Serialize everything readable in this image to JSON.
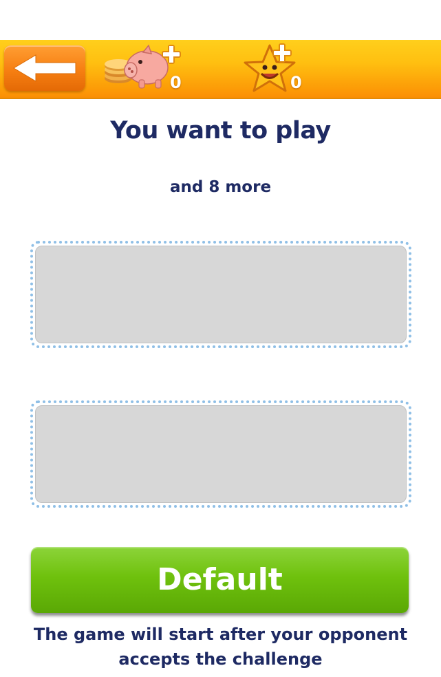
{
  "header": {
    "back_icon": "left-arrow-icon",
    "coins": {
      "icon": "piggy-bank-coins-icon",
      "count": "0"
    },
    "stars": {
      "icon": "smiling-star-icon",
      "count": "0"
    }
  },
  "main": {
    "title": "You want to play",
    "subtitle": "and 8 more",
    "default_button_label": "Default",
    "footer_message": "The game will start after your opponent accepts the challenge"
  },
  "colors": {
    "header_orange": "#fb8f04",
    "header_yellow": "#ffcf1c",
    "text_navy": "#1e2a63",
    "button_green": "#6fc10d",
    "slot_gray": "#d7d7d7",
    "slot_border_blue": "#8fbfe6"
  }
}
